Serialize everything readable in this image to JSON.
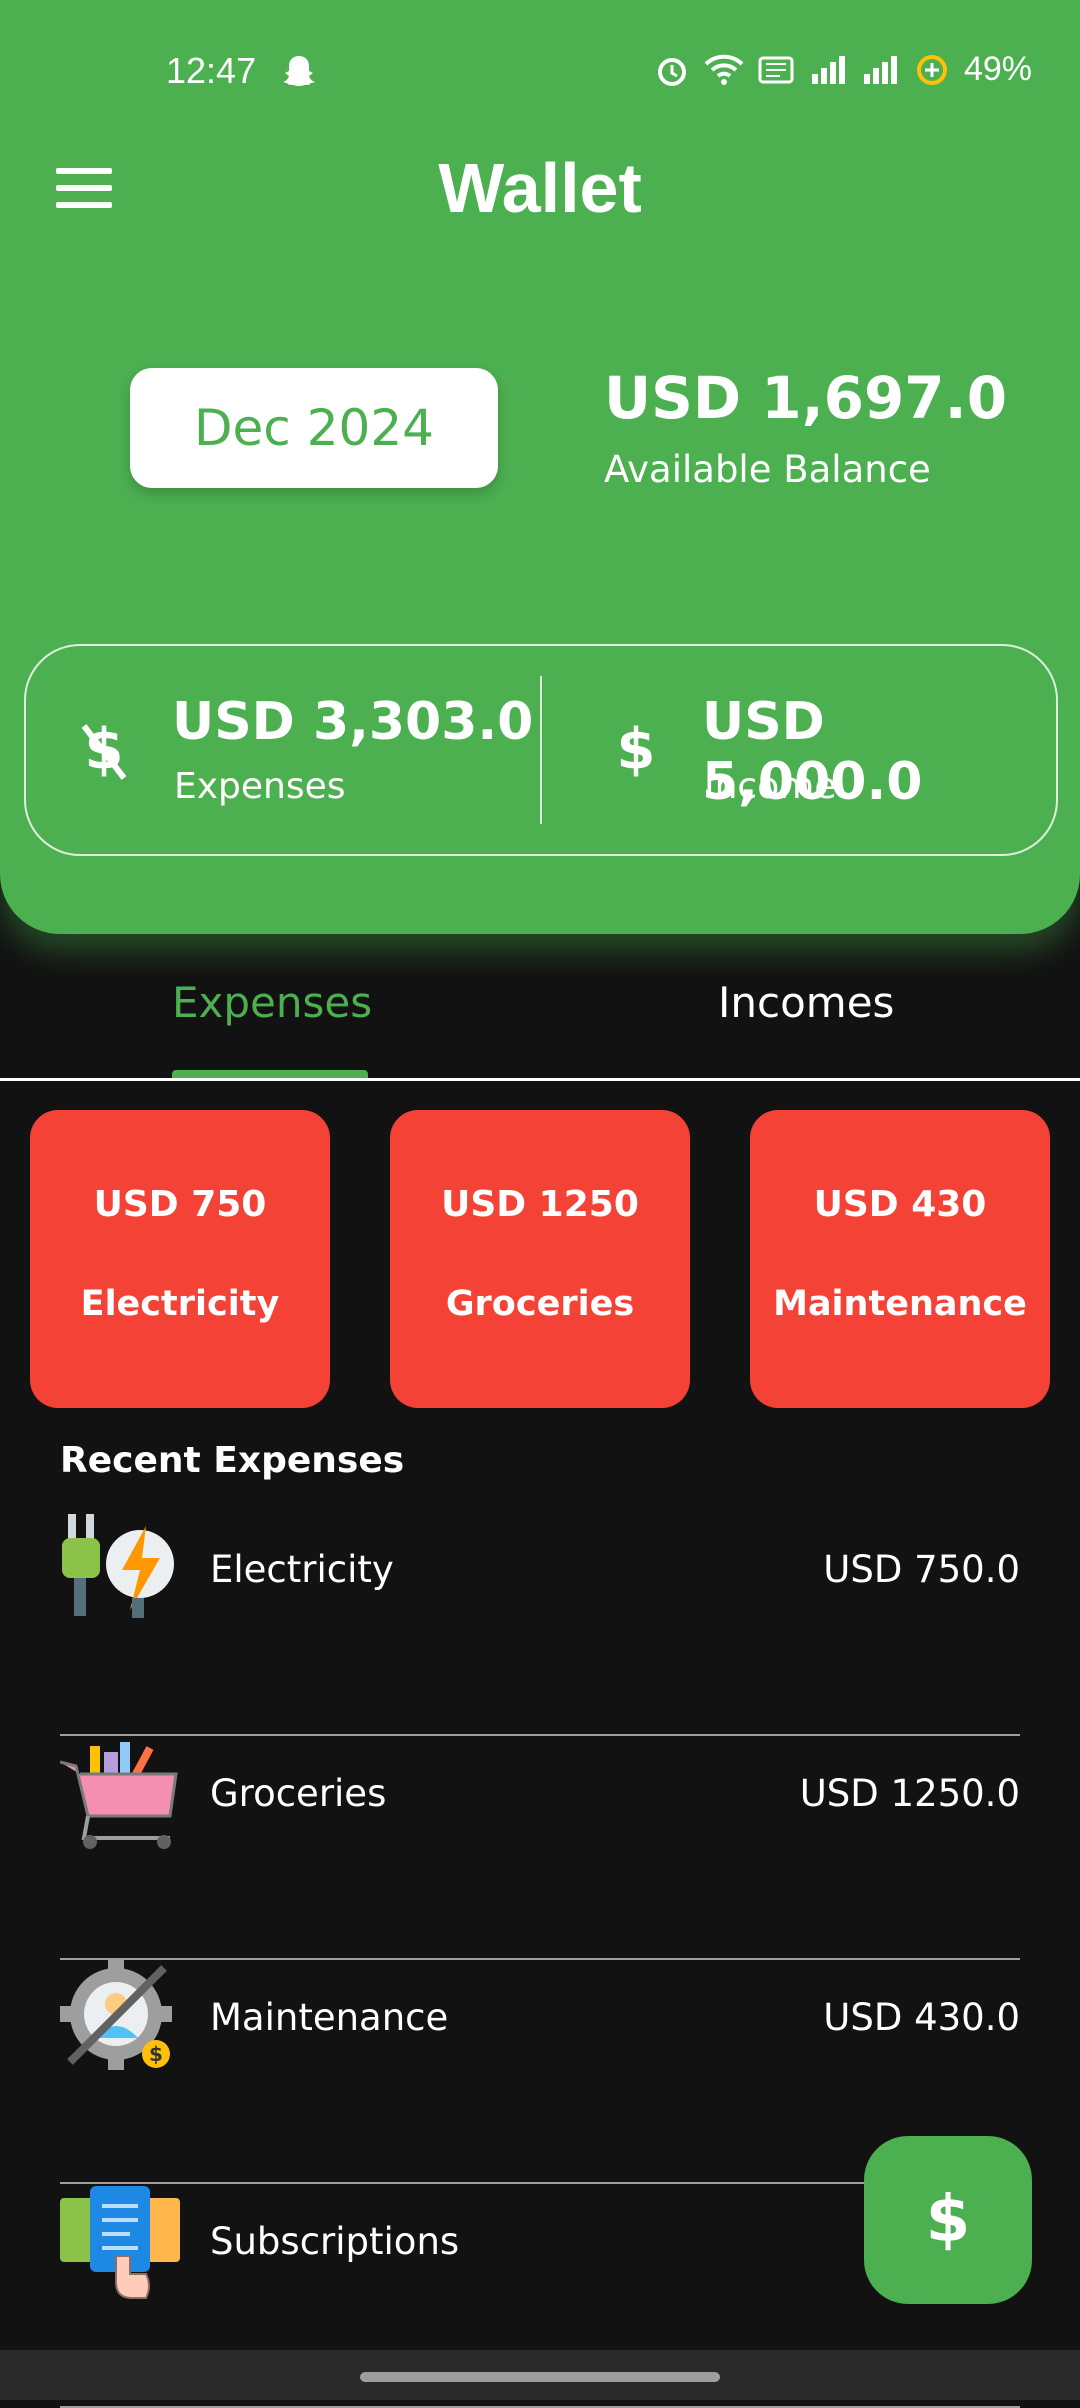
{
  "status_bar": {
    "time": "12:47",
    "battery": "49%",
    "icons": [
      "snapchat-ghost-icon",
      "alarm-icon",
      "wifi-icon",
      "volte-icon",
      "signal-icon",
      "signal-icon",
      "battery-saver-icon"
    ]
  },
  "app": {
    "title": "Wallet"
  },
  "header": {
    "month_button": "Dec 2024",
    "balance_value": "USD 1,697.0",
    "balance_label": "Available Balance",
    "expenses_value": "USD 3,303.0",
    "expenses_label": "Expenses",
    "income_value": "USD 5,000.0",
    "income_label": "Income"
  },
  "tabs": [
    {
      "label": "Expenses",
      "active": true
    },
    {
      "label": "Incomes",
      "active": false
    }
  ],
  "categories": [
    {
      "amount": "USD 750",
      "name": "Electricity"
    },
    {
      "amount": "USD 1250",
      "name": "Groceries"
    },
    {
      "amount": "USD 430",
      "name": "Maintenance"
    }
  ],
  "recent": {
    "title": "Recent Expenses",
    "items": [
      {
        "name": "Electricity",
        "amount": "USD 750.0",
        "icon": "electric-plug-icon"
      },
      {
        "name": "Groceries",
        "amount": "USD 1250.0",
        "icon": "shopping-cart-icon"
      },
      {
        "name": "Maintenance",
        "amount": "USD 430.0",
        "icon": "maintenance-gear-icon"
      },
      {
        "name": "Subscriptions",
        "amount": "",
        "icon": "subscriptions-cards-icon"
      }
    ]
  },
  "fab": {
    "label": "$"
  },
  "colors": {
    "primary": "#4CAF50",
    "card_red": "#F44336",
    "background": "#121212"
  }
}
